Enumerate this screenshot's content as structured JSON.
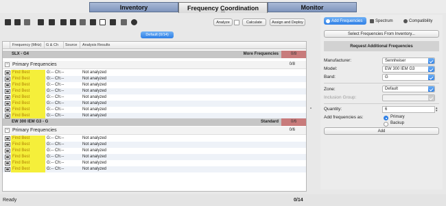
{
  "tabs": [
    "Inventory",
    "Frequency Coordination",
    "Monitor"
  ],
  "toolbar": {
    "analyze": "Analyze",
    "calculate": "Calculate",
    "assign_deploy": "Assign and Deploy"
  },
  "default_button": "Default (0/14)",
  "table": {
    "headers": [
      "Frequency (MHz)",
      "G & Ch",
      "Source",
      "Analysis Results"
    ],
    "groups": [
      {
        "name": "SLX - G4",
        "type": "More Frequencies",
        "count": "0/8",
        "section": "Primary Frequencies",
        "section_count": "0/8",
        "rows": [
          {
            "find": "Find Best",
            "gch": "G:-- Ch:--",
            "status": "Not analyzed"
          },
          {
            "find": "Find Best",
            "gch": "G:-- Ch:--",
            "status": "Not analyzed"
          },
          {
            "find": "Find Best",
            "gch": "G:-- Ch:--",
            "status": "Not analyzed"
          },
          {
            "find": "Find Best",
            "gch": "G:-- Ch:--",
            "status": "Not analyzed"
          },
          {
            "find": "Find Best",
            "gch": "G:-- Ch:--",
            "status": "Not analyzed"
          },
          {
            "find": "Find Best",
            "gch": "G:-- Ch:--",
            "status": "Not analyzed"
          },
          {
            "find": "Find Best",
            "gch": "G:-- Ch:--",
            "status": "Not analyzed"
          },
          {
            "find": "Find Best",
            "gch": "G:-- Ch:--",
            "status": "Not analyzed"
          }
        ]
      },
      {
        "name": "EW 300 IEM G3 - G",
        "type": "Standard",
        "count": "0/6",
        "section": "Primary Frequencies",
        "section_count": "0/6",
        "rows": [
          {
            "find": "Find Best",
            "gch": "G:-- Ch:--",
            "status": "Not analyzed"
          },
          {
            "find": "Find Best",
            "gch": "G:-- Ch:--",
            "status": "Not analyzed"
          },
          {
            "find": "Find Best",
            "gch": "G:-- Ch:--",
            "status": "Not analyzed"
          },
          {
            "find": "Find Best",
            "gch": "G:-- Ch:--",
            "status": "Not analyzed"
          },
          {
            "find": "Find Best",
            "gch": "G:-- Ch:--",
            "status": "Not analyzed"
          },
          {
            "find": "Find Best",
            "gch": "G:-- Ch:--",
            "status": "Not analyzed"
          }
        ]
      }
    ]
  },
  "status": {
    "ready": "Ready",
    "count": "0/14"
  },
  "right_panel": {
    "tabs": [
      "Add Frequencies",
      "Spectrum",
      "Compatibility"
    ],
    "select_inventory": "Select Frequencies From Inventory...",
    "request_header": "Request Additional Frequencies",
    "fields": {
      "manufacturer_label": "Manufacturer:",
      "manufacturer_value": "Sennheiser",
      "model_label": "Model:",
      "model_value": "EW 300 IEM G3",
      "band_label": "Band:",
      "band_value": "G",
      "zone_label": "Zone:",
      "zone_value": "Default",
      "inclusion_label": "Inclusion Group:",
      "inclusion_value": "",
      "quantity_label": "Quantity:",
      "quantity_value": "6",
      "add_as_label": "Add frequencies as:",
      "primary_label": "Primary",
      "backup_label": "Backup"
    },
    "add_button": "Add"
  },
  "colors": {
    "accent": "#2f80e6",
    "highlight": "#f5ef3a",
    "count_bg": "#c87b7b"
  }
}
